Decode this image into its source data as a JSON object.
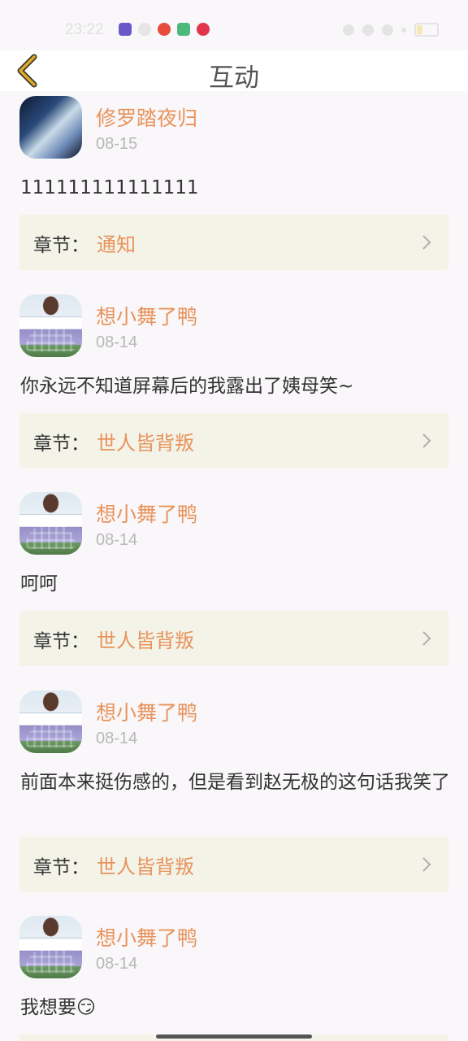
{
  "status_bar": {
    "time": "23:22"
  },
  "header": {
    "title": "互动",
    "back_icon": "chevron-left-icon",
    "accent": "#e0a92a"
  },
  "comments": [
    {
      "username": "修罗踏夜归",
      "date": "08-15",
      "text": "111111111111111",
      "chapter_prefix": "章节：",
      "chapter_name": "通知",
      "avatar": "anime"
    },
    {
      "username": "想小舞了鸭",
      "date": "08-14",
      "text": "你永远不知道屏幕后的我露出了姨母笑~",
      "chapter_prefix": "章节：",
      "chapter_name": "世人皆背叛",
      "avatar": "girl"
    },
    {
      "username": "想小舞了鸭",
      "date": "08-14",
      "text": "呵呵",
      "chapter_prefix": "章节：",
      "chapter_name": "世人皆背叛",
      "avatar": "girl"
    },
    {
      "username": "想小舞了鸭",
      "date": "08-14",
      "text": "前面本来挺伤感的，但是看到赵无极的这句话我笑了",
      "chapter_prefix": "章节：",
      "chapter_name": "世人皆背叛",
      "avatar": "girl"
    },
    {
      "username": "想小舞了鸭",
      "date": "08-14",
      "text": "我想要😏",
      "avatar": "girl"
    }
  ],
  "colors": {
    "username": "#e8935c",
    "chapter_bg": "#f3f3e8",
    "page_bg": "#f9f7f9"
  }
}
